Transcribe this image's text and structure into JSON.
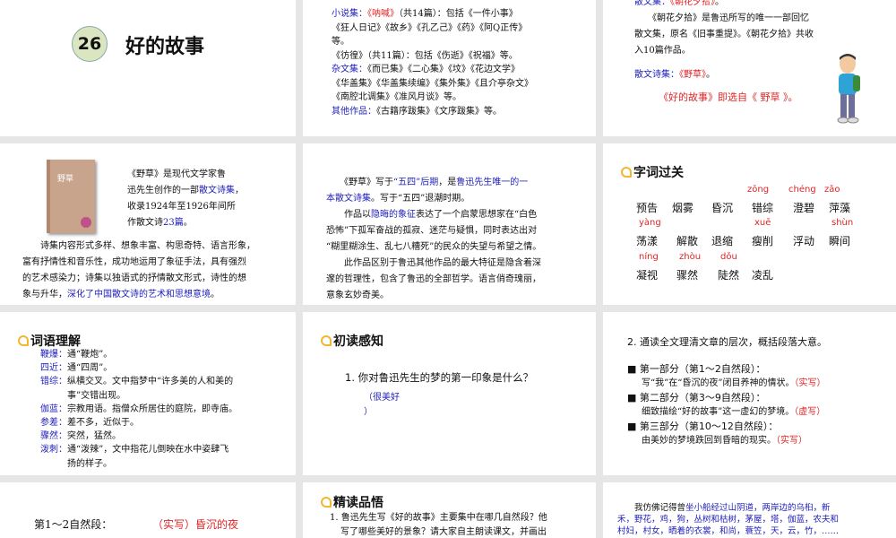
{
  "colors": {
    "blue": "#2222bb",
    "red": "#e02424",
    "accent": "#f2b632",
    "circle": "#dbe6c0"
  },
  "slide1": {
    "number": "26",
    "title": "好的故事"
  },
  "slide2": {
    "lines": [
      [
        [
          "小说集：",
          "b"
        ],
        [
          "《呐喊》",
          "r"
        ],
        [
          "（共14篇）：包括《一件小事》",
          "k"
        ]
      ],
      [
        [
          "《狂人日记》《故乡》《孔乙己》《药》《阿Q正传》",
          "k"
        ]
      ],
      [
        [
          "等。",
          "k"
        ]
      ],
      [
        [
          "《彷徨》（共11篇）：包括《伤逝》《祝福》等。",
          "k"
        ]
      ],
      [
        [
          "杂文集：",
          "b"
        ],
        [
          "《而已集》《二心集》《坟》《花边文学》",
          "k"
        ]
      ],
      [
        [
          "《华盖集》《华盖集续编》《集外集》《且介亭杂文》",
          "k"
        ]
      ],
      [
        [
          "《南腔北调集》《准风月谈》等。",
          "k"
        ]
      ],
      [
        [
          "其他作品：",
          "b"
        ],
        [
          "《古籍序跋集》《文序跋集》等。",
          "k"
        ]
      ]
    ]
  },
  "slide3": {
    "lines": [
      [
        [
          "散文集：",
          "b"
        ],
        [
          "《朝花夕拾》",
          "r"
        ],
        [
          "。",
          "k"
        ]
      ],
      [
        [
          "　　《朝花夕拾》是鲁迅所写的唯一一部回忆",
          "k"
        ]
      ],
      [
        [
          "散文集，原名《旧事重提》。《朝花夕拾》共收",
          "k"
        ]
      ],
      [
        [
          "入10篇作品。",
          "k"
        ]
      ]
    ],
    "poem": [
      [
        "散文诗集：",
        "b"
      ],
      [
        "《野草》",
        "r"
      ],
      [
        "。",
        "k"
      ]
    ],
    "note": [
      [
        "《好的故事》即选自《 野草 》。",
        "r"
      ]
    ],
    "book_cover_text": "野草"
  },
  "slide4": {
    "book_title": "野草",
    "intro": [
      [
        [
          "《野草》是现代文学家鲁",
          "k"
        ]
      ],
      [
        [
          "迅先生创作的一部",
          "k"
        ],
        [
          "散文诗集",
          "b"
        ],
        [
          "，",
          "k"
        ]
      ],
      [
        [
          "收录1924年至1926年间所",
          "k"
        ]
      ],
      [
        [
          "作散文诗",
          "k"
        ],
        [
          "23篇",
          "b"
        ],
        [
          "。",
          "k"
        ]
      ]
    ],
    "body": [
      [
        [
          "　　诗集内容形式多样、想象丰富、构思奇特、语言形象，",
          "k"
        ]
      ],
      [
        [
          "富有抒情性和音乐性，成功地运用了象征手法，具有强烈",
          "k"
        ]
      ],
      [
        [
          "的艺术感染力；诗集以独语式的抒情散文形式，诗性的想",
          "k"
        ]
      ],
      [
        [
          "象与升华，",
          "k"
        ],
        [
          "深化了中国散文诗的艺术和思想意境",
          "b"
        ],
        [
          "。",
          "k"
        ]
      ]
    ]
  },
  "slide5": {
    "lines": [
      [
        [
          "　　《野草》写于",
          "k"
        ],
        [
          "“五四”后期",
          "b"
        ],
        [
          "，是",
          "k"
        ],
        [
          "鲁迅先生唯一的一",
          "b"
        ]
      ],
      [
        [
          "本散文诗集",
          "b"
        ],
        [
          "。写于“五四”退潮时期。",
          "k"
        ]
      ],
      [
        [
          "　　作品以",
          "k"
        ],
        [
          "隐晦的象征",
          "b"
        ],
        [
          "表达了一个启蒙思想家在“白色",
          "k"
        ]
      ],
      [
        [
          "恐怖”下孤军奋战的孤寂、迷茫与疑惧，同时表达出对",
          "k"
        ]
      ],
      [
        [
          "“糊里糊涂生、乱七八糟死”的民众的失望与希望之情。",
          "k"
        ]
      ],
      [
        [
          "　　此作品区别于鲁迅其他作品的最大特征是隐含着深",
          "k"
        ]
      ],
      [
        [
          "邃的哲理性，包含了鲁迅的全部哲学。语言俏奇瑰丽，",
          "k"
        ]
      ],
      [
        [
          "意象玄妙奇美。",
          "k"
        ]
      ]
    ]
  },
  "slide6": {
    "title": "字词过关",
    "words": [
      {
        "w": "预告",
        "py": ""
      },
      {
        "w": "烟雾",
        "py": ""
      },
      {
        "w": "昏沉",
        "py": ""
      },
      {
        "w": "错综",
        "py": "zōng"
      },
      {
        "w": "澄碧",
        "py": "chéng"
      },
      {
        "w": "萍藻",
        "py": "zǎo"
      },
      {
        "w": "荡漾",
        "py": "yàng"
      },
      {
        "w": "解散",
        "py": ""
      },
      {
        "w": "退缩",
        "py": ""
      },
      {
        "w": "瘦削",
        "py": "xuē"
      },
      {
        "w": "浮动",
        "py": ""
      },
      {
        "w": "瞬间",
        "py": "shùn"
      },
      {
        "w": "凝视",
        "py": "níng"
      },
      {
        "w": "骤然",
        "py": "zhòu"
      },
      {
        "w": "陡然",
        "py": "dǒu"
      },
      {
        "w": "凌乱",
        "py": ""
      }
    ]
  },
  "slide7": {
    "title": "词语理解",
    "lines": [
      [
        [
          "鞭爆：",
          "b"
        ],
        [
          "通“鞭炮”。",
          "k"
        ]
      ],
      [
        [
          "四近：",
          "b"
        ],
        [
          "通“四周”。",
          "k"
        ]
      ],
      [
        [
          "错综：",
          "b"
        ],
        [
          "纵横交叉。文中指梦中“许多美的人和美的",
          "k"
        ]
      ],
      [
        [
          "　　　事”交错出现。",
          "k"
        ]
      ],
      [
        [
          "伽蓝：",
          "b"
        ],
        [
          "宗教用语。指僧众所居住的庭院，即寺庙。",
          "k"
        ]
      ],
      [
        [
          "参差：",
          "b"
        ],
        [
          "差不多，近似于。",
          "k"
        ]
      ],
      [
        [
          "骤然：",
          "b"
        ],
        [
          "突然，猛然。",
          "k"
        ]
      ],
      [
        [
          "泼刺：",
          "b"
        ],
        [
          "通“泼辣”，文中指花儿倒映在水中姿肆飞",
          "k"
        ]
      ],
      [
        [
          "　　　扬的样子。",
          "k"
        ]
      ]
    ]
  },
  "slide8": {
    "title": "初读感知",
    "question": "1. 你对鲁迅先生的梦的第一印象是什么？",
    "answer_line1": "（很美好",
    "answer_line2": "）"
  },
  "slide9": {
    "heading": "2. 通读全文理清文章的层次，概括段落大意。",
    "parts": [
      {
        "head": "第一部分（第1～2自然段）：",
        "desc": "写“我”在“昏沉的夜”闭目养神的情状。",
        "tag": "（实写）"
      },
      {
        "head": "第二部分（第3～9自然段）：",
        "desc": "细致描绘“好的故事”这一虚幻的梦境。",
        "tag": "（虚写）"
      },
      {
        "head": "第三部分（第10～12自然段）：",
        "desc": "由美妙的梦境跌回到昏暗的现实。",
        "tag": "（实写）"
      }
    ]
  },
  "slide10": {
    "label": "第1～2自然段：",
    "value": "（实写）昏沉的夜"
  },
  "slide11": {
    "title": "精读品悟",
    "lines": [
      "1. 鲁迅先生写《好的故事》主要集中在哪几自然段？他",
      "写了哪些美好的景象？请大家自主朗读课文，并画出"
    ]
  },
  "slide12": {
    "lines": [
      [
        [
          "　　我仿佛记得曾",
          "k"
        ],
        [
          "坐小船经过山阴道，两岸边的乌桕，新",
          "b"
        ]
      ],
      [
        [
          "禾，野花，鸡，狗，丛树和枯树，茅屋，塔，伽蓝，农夫和",
          "b"
        ]
      ],
      [
        [
          "村妇，村女，晒着的衣裳，和尚，蓑笠，天，云，竹，……",
          "b"
        ]
      ]
    ]
  }
}
